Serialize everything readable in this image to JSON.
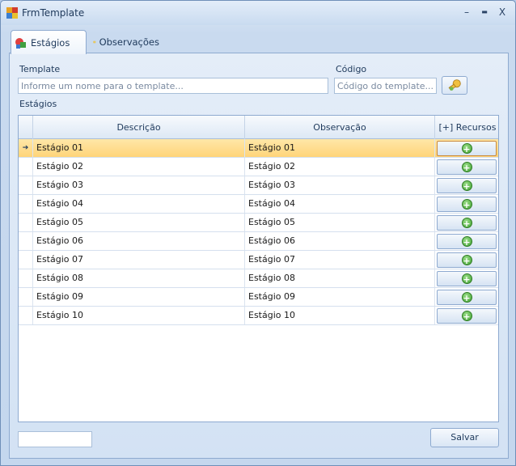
{
  "window": {
    "title": "FrmTemplate",
    "minimize": "–",
    "maximize": "▬",
    "close": "X"
  },
  "tabs": [
    {
      "label": "Estágios",
      "icon": "colored-boxes-icon",
      "active": true
    },
    {
      "label": "Observações",
      "icon": "notes-icon",
      "active": false
    }
  ],
  "form": {
    "template_label": "Template",
    "template_placeholder": "Informe um nome para o template...",
    "codigo_label": "Código",
    "codigo_placeholder": "Código do template...",
    "estagios_label": "Estágios"
  },
  "grid": {
    "columns": [
      "Descrição",
      "Observação",
      "[+] Recursos"
    ],
    "selected_indicator": "➔",
    "rows": [
      {
        "descricao": "Estágio 01",
        "observacao": "Estágio 01"
      },
      {
        "descricao": "Estágio 02",
        "observacao": "Estágio 02"
      },
      {
        "descricao": "Estágio 03",
        "observacao": "Estágio 03"
      },
      {
        "descricao": "Estágio 04",
        "observacao": "Estágio 04"
      },
      {
        "descricao": "Estágio 05",
        "observacao": "Estágio 05"
      },
      {
        "descricao": "Estágio 06",
        "observacao": "Estágio 06"
      },
      {
        "descricao": "Estágio 07",
        "observacao": "Estágio 07"
      },
      {
        "descricao": "Estágio 08",
        "observacao": "Estágio 08"
      },
      {
        "descricao": "Estágio 09",
        "observacao": "Estágio 09"
      },
      {
        "descricao": "Estágio 10",
        "observacao": "Estágio 10"
      }
    ],
    "add_symbol": "+"
  },
  "footer": {
    "save_label": "Salvar"
  },
  "colors": {
    "selected_row": "#ffd479",
    "accent": "#1e395b"
  }
}
